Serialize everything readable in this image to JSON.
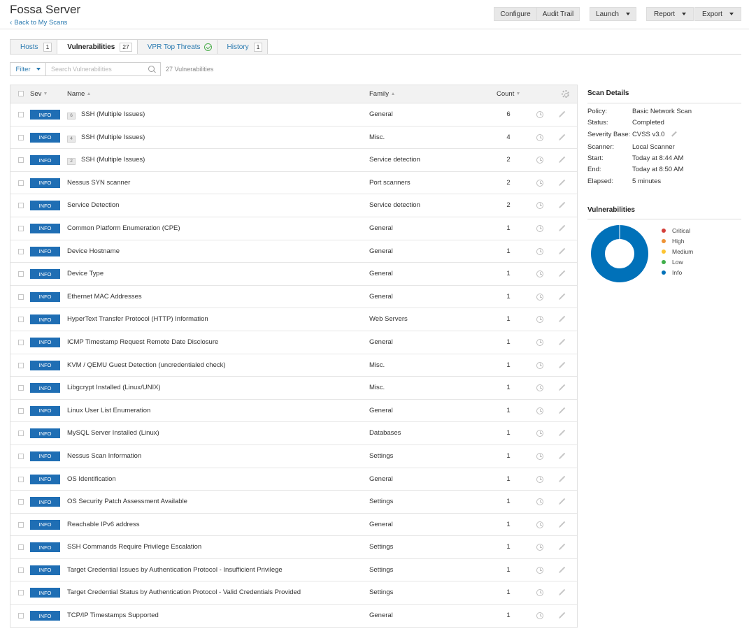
{
  "header": {
    "title": "Fossa Server",
    "back_link": "Back to My Scans",
    "buttons": {
      "configure": "Configure",
      "audit_trail": "Audit Trail",
      "launch": "Launch",
      "report": "Report",
      "export": "Export"
    }
  },
  "tabs": [
    {
      "label": "Hosts",
      "count": "1"
    },
    {
      "label": "Vulnerabilities",
      "count": "27"
    },
    {
      "label": "VPR Top Threats"
    },
    {
      "label": "History",
      "count": "1"
    }
  ],
  "filter": {
    "label": "Filter",
    "search_placeholder": "Search Vulnerabilities",
    "result_count": "27 Vulnerabilities"
  },
  "table": {
    "columns": {
      "sev": "Sev",
      "name": "Name",
      "family": "Family",
      "count": "Count"
    },
    "rows": [
      {
        "sev": "INFO",
        "group": "6",
        "name": "SSH (Multiple Issues)",
        "family": "General",
        "count": "6"
      },
      {
        "sev": "INFO",
        "group": "4",
        "name": "SSH (Multiple Issues)",
        "family": "Misc.",
        "count": "4"
      },
      {
        "sev": "INFO",
        "group": "2",
        "name": "SSH (Multiple Issues)",
        "family": "Service detection",
        "count": "2"
      },
      {
        "sev": "INFO",
        "name": "Nessus SYN scanner",
        "family": "Port scanners",
        "count": "2"
      },
      {
        "sev": "INFO",
        "name": "Service Detection",
        "family": "Service detection",
        "count": "2"
      },
      {
        "sev": "INFO",
        "name": "Common Platform Enumeration (CPE)",
        "family": "General",
        "count": "1"
      },
      {
        "sev": "INFO",
        "name": "Device Hostname",
        "family": "General",
        "count": "1"
      },
      {
        "sev": "INFO",
        "name": "Device Type",
        "family": "General",
        "count": "1"
      },
      {
        "sev": "INFO",
        "name": "Ethernet MAC Addresses",
        "family": "General",
        "count": "1"
      },
      {
        "sev": "INFO",
        "name": "HyperText Transfer Protocol (HTTP) Information",
        "family": "Web Servers",
        "count": "1"
      },
      {
        "sev": "INFO",
        "name": "ICMP Timestamp Request Remote Date Disclosure",
        "family": "General",
        "count": "1"
      },
      {
        "sev": "INFO",
        "name": "KVM / QEMU Guest Detection (uncredentialed check)",
        "family": "Misc.",
        "count": "1"
      },
      {
        "sev": "INFO",
        "name": "Libgcrypt Installed (Linux/UNIX)",
        "family": "Misc.",
        "count": "1"
      },
      {
        "sev": "INFO",
        "name": "Linux User List Enumeration",
        "family": "General",
        "count": "1"
      },
      {
        "sev": "INFO",
        "name": "MySQL Server Installed (Linux)",
        "family": "Databases",
        "count": "1"
      },
      {
        "sev": "INFO",
        "name": "Nessus Scan Information",
        "family": "Settings",
        "count": "1"
      },
      {
        "sev": "INFO",
        "name": "OS Identification",
        "family": "General",
        "count": "1"
      },
      {
        "sev": "INFO",
        "name": "OS Security Patch Assessment Available",
        "family": "Settings",
        "count": "1"
      },
      {
        "sev": "INFO",
        "name": "Reachable IPv6 address",
        "family": "General",
        "count": "1"
      },
      {
        "sev": "INFO",
        "name": "SSH Commands Require Privilege Escalation",
        "family": "Settings",
        "count": "1"
      },
      {
        "sev": "INFO",
        "name": "Target Credential Issues by Authentication Protocol - Insufficient Privilege",
        "family": "Settings",
        "count": "1"
      },
      {
        "sev": "INFO",
        "name": "Target Credential Status by Authentication Protocol - Valid Credentials Provided",
        "family": "Settings",
        "count": "1"
      },
      {
        "sev": "INFO",
        "name": "TCP/IP Timestamps Supported",
        "family": "General",
        "count": "1"
      }
    ]
  },
  "scan_details": {
    "title": "Scan Details",
    "items": [
      {
        "label": "Policy:",
        "value": "Basic Network Scan"
      },
      {
        "label": "Status:",
        "value": "Completed"
      },
      {
        "label": "Severity Base:",
        "value": "CVSS v3.0"
      },
      {
        "label": "Scanner:",
        "value": "Local Scanner"
      },
      {
        "label": "Start:",
        "value": "Today at 8:44 AM"
      },
      {
        "label": "End:",
        "value": "Today at 8:50 AM"
      },
      {
        "label": "Elapsed:",
        "value": "5 minutes"
      }
    ]
  },
  "vulnerabilities_chart": {
    "title": "Vulnerabilities",
    "legend": [
      {
        "label": "Critical",
        "color": "#d43f3a",
        "value": 0
      },
      {
        "label": "High",
        "color": "#ee9336",
        "value": 0
      },
      {
        "label": "Medium",
        "color": "#fdc431",
        "value": 0
      },
      {
        "label": "Low",
        "color": "#3fae49",
        "value": 0
      },
      {
        "label": "Info",
        "color": "#0071b9",
        "value": 27
      }
    ]
  },
  "colors": {
    "accent": "#2a7ab0",
    "info_badge": "#1f6eb4"
  }
}
